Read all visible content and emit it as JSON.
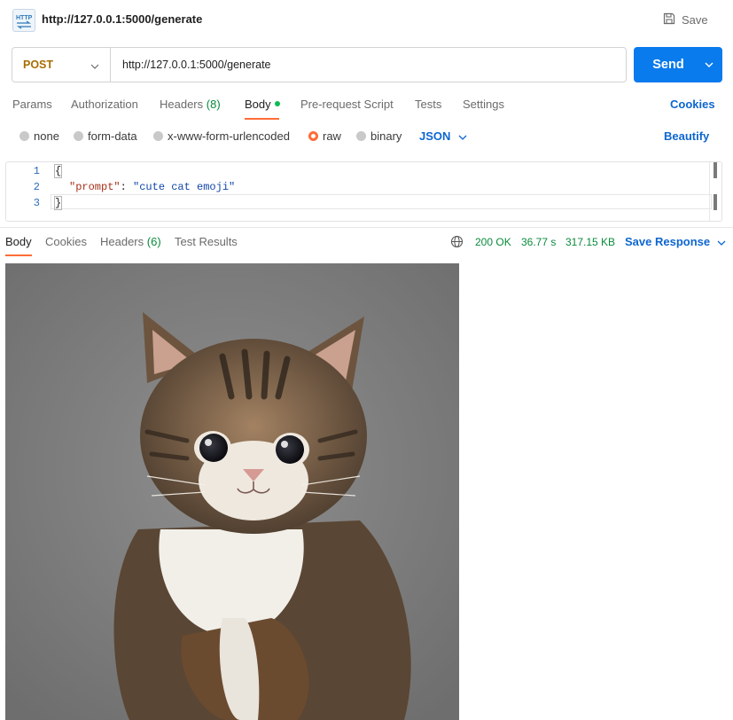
{
  "header": {
    "title": "http://127.0.0.1:5000/generate",
    "save_label": "Save",
    "request_icon": "http-icon"
  },
  "request": {
    "method": "POST",
    "url": "http://127.0.0.1:5000/generate",
    "send_label": "Send"
  },
  "tabs": [
    {
      "label": "Params"
    },
    {
      "label": "Authorization"
    },
    {
      "label": "Headers",
      "count": "(8)"
    },
    {
      "label": "Body"
    },
    {
      "label": "Pre-request Script"
    },
    {
      "label": "Tests"
    },
    {
      "label": "Settings"
    }
  ],
  "cookies_label": "Cookies",
  "body_types": [
    {
      "label": "none",
      "selected": false
    },
    {
      "label": "form-data",
      "selected": false
    },
    {
      "label": "x-www-form-urlencoded",
      "selected": false
    },
    {
      "label": "raw",
      "selected": true
    },
    {
      "label": "binary",
      "selected": false
    }
  ],
  "raw_format": "JSON",
  "beautify_label": "Beautify",
  "editor": {
    "line_numbers": [
      "1",
      "2",
      "3"
    ],
    "open_brace": "{",
    "key": "\"prompt\"",
    "colon": ": ",
    "value": "\"cute cat emoji\"",
    "close_brace": "}"
  },
  "response": {
    "tabs": [
      {
        "label": "Body"
      },
      {
        "label": "Cookies"
      },
      {
        "label": "Headers",
        "count": "(6)"
      },
      {
        "label": "Test Results"
      }
    ],
    "status": "200 OK",
    "time": "36.77 s",
    "size": "317.15 KB",
    "save_response_label": "Save Response"
  },
  "colors": {
    "accent": "#ff6c37",
    "primary": "#097bed",
    "link": "#0d66d0",
    "method": "#a66d00",
    "success": "#0a8a3c"
  }
}
